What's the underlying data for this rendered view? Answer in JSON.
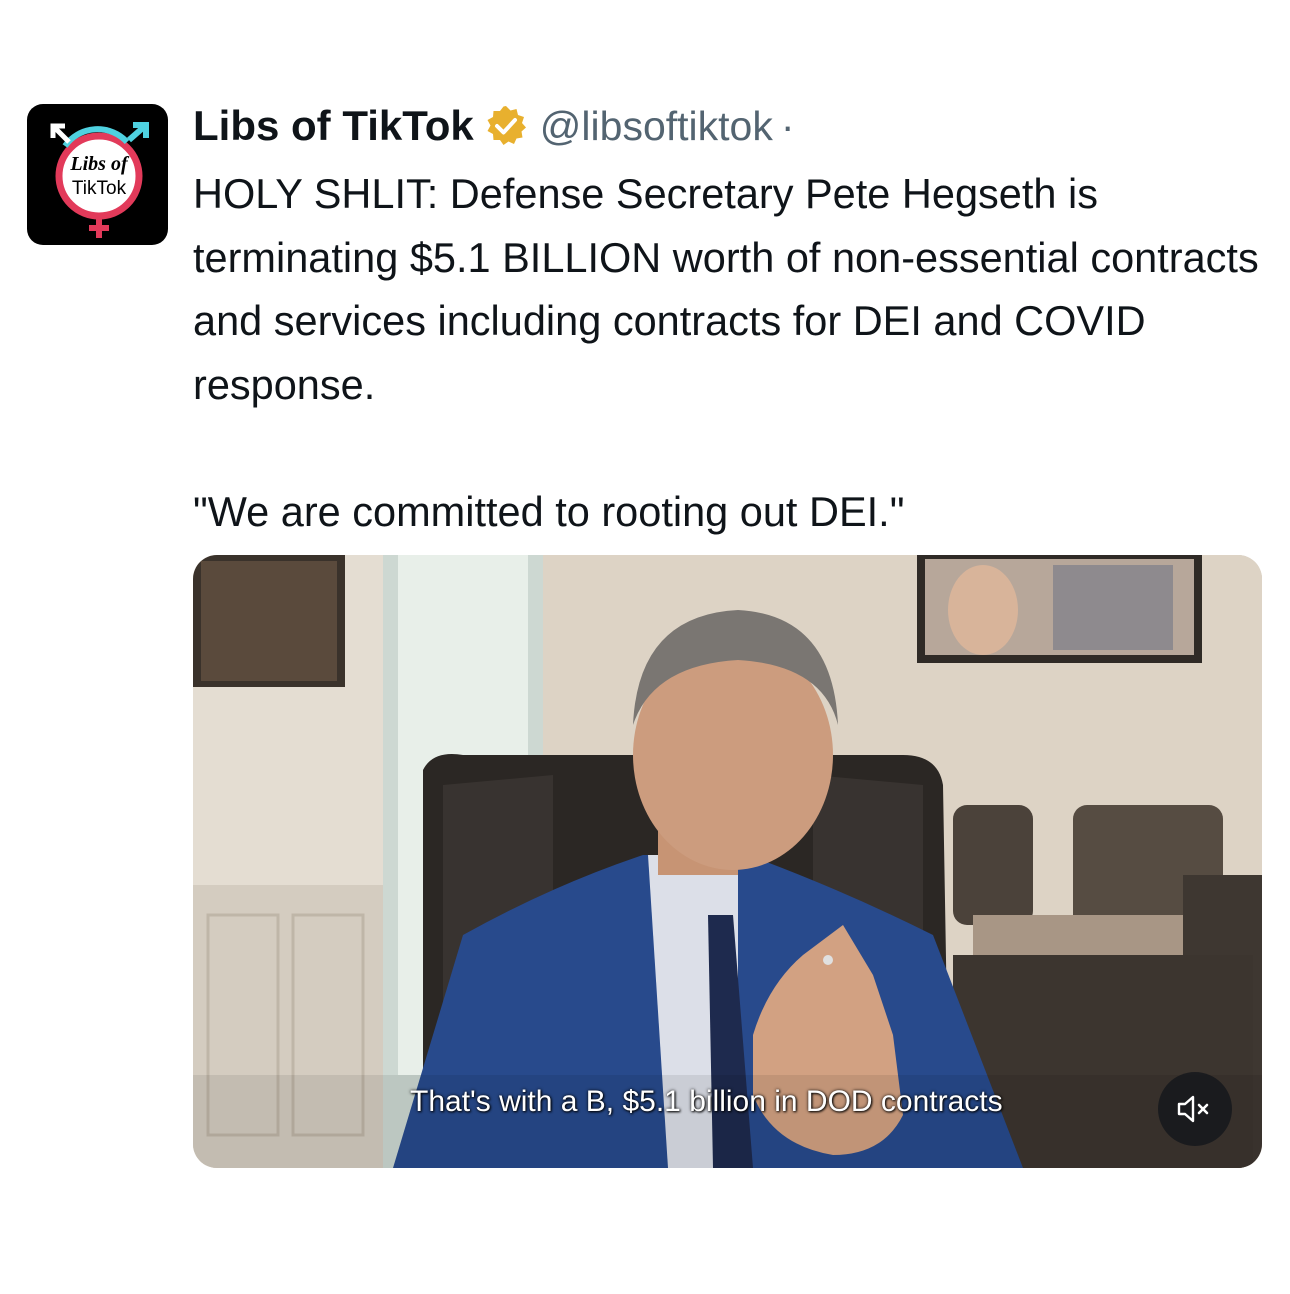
{
  "account": {
    "display_name": "Libs of TikTok",
    "handle": "@libsoftiktok",
    "separator": "·",
    "verified_badge": "gold-verified-badge-icon",
    "avatar_text_line1": "Libs of",
    "avatar_text_line2": "TikTok"
  },
  "tweet": {
    "text": "HOLY SHLIT: Defense Secretary Pete Hegseth is terminating $5.1 BILLION worth of non-essential contracts and services including contracts for DEI and COVID response.\n\n\"We are committed to rooting out DEI.\""
  },
  "media": {
    "type": "video",
    "caption": "That's with a B, $5.1 billion in DOD contracts",
    "mute_icon": "volume-muted-icon"
  },
  "colors": {
    "text_primary": "#0f1419",
    "text_secondary": "#536471",
    "verified_gold": "#e8b02e",
    "avatar_bg": "#000000"
  }
}
